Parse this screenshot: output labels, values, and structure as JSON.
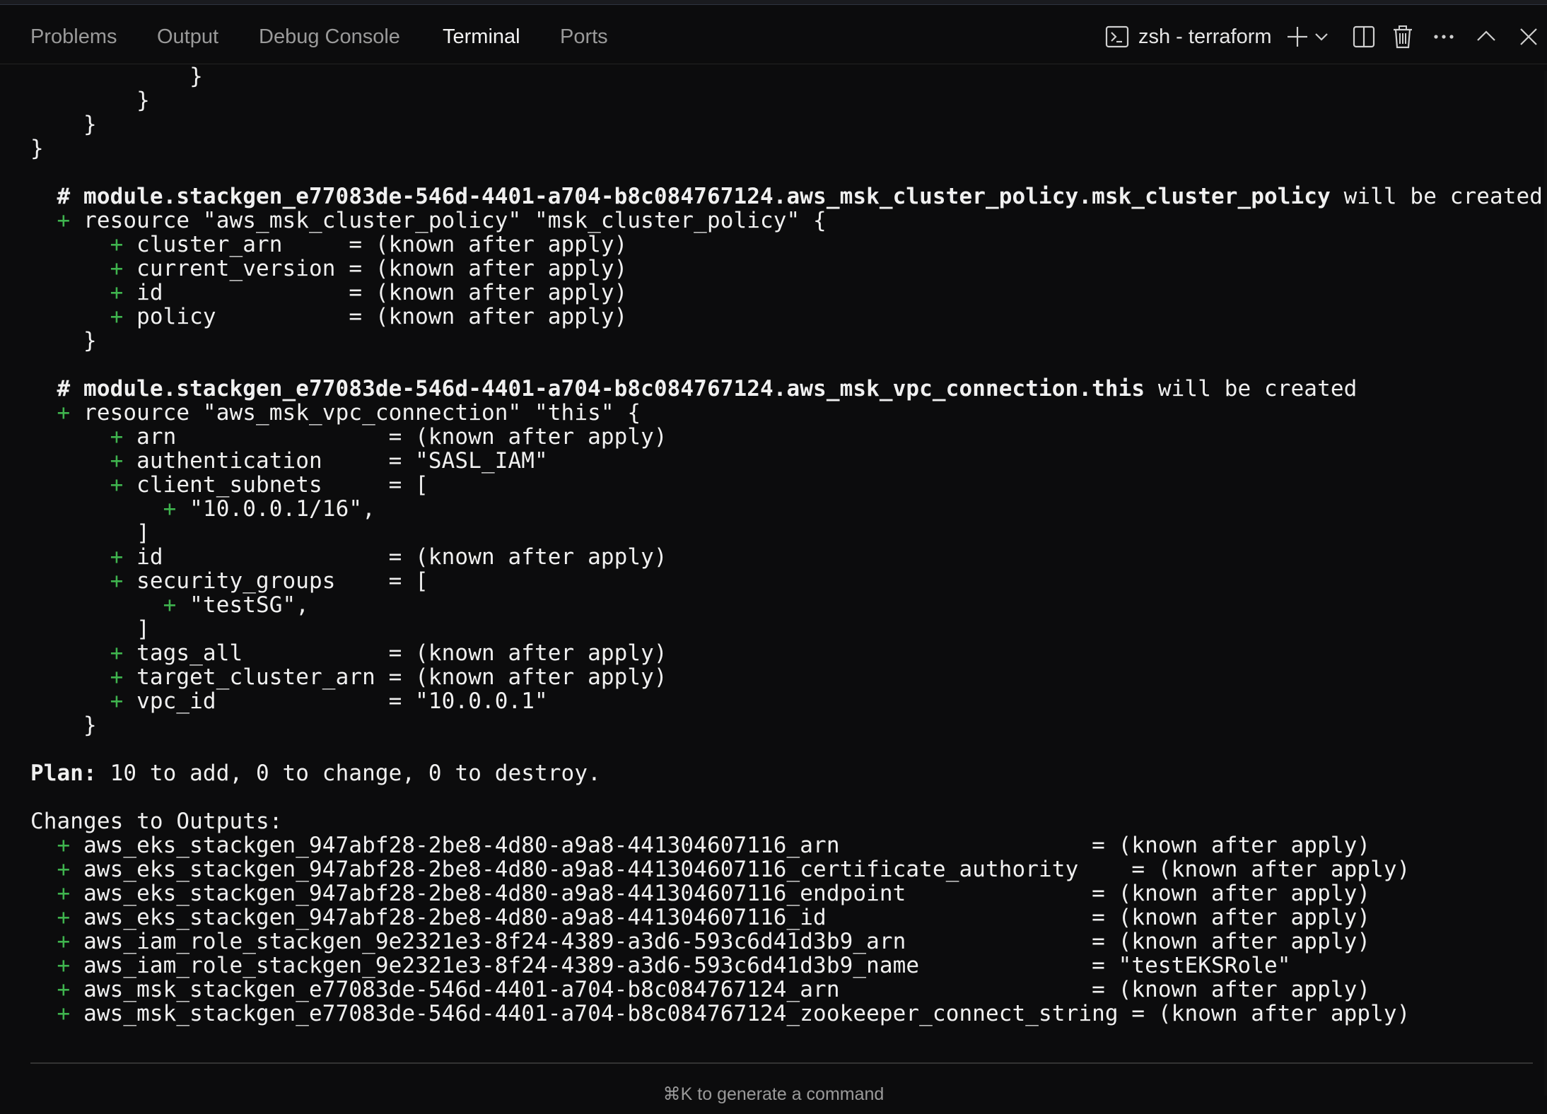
{
  "panel": {
    "tabs": [
      {
        "label": "Problems",
        "active": false
      },
      {
        "label": "Output",
        "active": false
      },
      {
        "label": "Debug Console",
        "active": false
      },
      {
        "label": "Terminal",
        "active": true
      },
      {
        "label": "Ports",
        "active": false
      }
    ],
    "terminal_name": "zsh - terraform",
    "icons": [
      "terminal-icon",
      "plus-icon",
      "chevron-down-icon",
      "split-icon",
      "trash-icon",
      "more-icon",
      "chevron-up-icon",
      "close-icon"
    ]
  },
  "colors": {
    "background": "#0c0c0d",
    "plus_sign": "#3fb44e",
    "text": "#f0f0f0",
    "tab_inactive": "#9a9a9a"
  },
  "terminal": {
    "lines": [
      {
        "segments": [
          {
            "text": "            }"
          }
        ]
      },
      {
        "segments": [
          {
            "text": "        }"
          }
        ]
      },
      {
        "segments": [
          {
            "text": "    }"
          }
        ]
      },
      {
        "segments": [
          {
            "text": "}"
          }
        ]
      },
      {
        "segments": [
          {
            "text": ""
          }
        ]
      },
      {
        "segments": [
          {
            "text": "  # module.stackgen_e77083de-546d-4401-a704-b8c084767124.aws_msk_cluster_policy.msk_cluster_policy",
            "bold": true
          },
          {
            "text": " will be created"
          }
        ]
      },
      {
        "segments": [
          {
            "text": "  + ",
            "plus": true
          },
          {
            "text": "resource \"aws_msk_cluster_policy\" \"msk_cluster_policy\" {"
          }
        ]
      },
      {
        "segments": [
          {
            "text": "      + ",
            "plus": true
          },
          {
            "text": "cluster_arn     = (known after apply)"
          }
        ]
      },
      {
        "segments": [
          {
            "text": "      + ",
            "plus": true
          },
          {
            "text": "current_version = (known after apply)"
          }
        ]
      },
      {
        "segments": [
          {
            "text": "      + ",
            "plus": true
          },
          {
            "text": "id              = (known after apply)"
          }
        ]
      },
      {
        "segments": [
          {
            "text": "      + ",
            "plus": true
          },
          {
            "text": "policy          = (known after apply)"
          }
        ]
      },
      {
        "segments": [
          {
            "text": "    }"
          }
        ]
      },
      {
        "segments": [
          {
            "text": ""
          }
        ]
      },
      {
        "segments": [
          {
            "text": "  # module.stackgen_e77083de-546d-4401-a704-b8c084767124.aws_msk_vpc_connection.this",
            "bold": true
          },
          {
            "text": " will be created"
          }
        ]
      },
      {
        "segments": [
          {
            "text": "  + ",
            "plus": true
          },
          {
            "text": "resource \"aws_msk_vpc_connection\" \"this\" {"
          }
        ]
      },
      {
        "segments": [
          {
            "text": "      + ",
            "plus": true
          },
          {
            "text": "arn                = (known after apply)"
          }
        ]
      },
      {
        "segments": [
          {
            "text": "      + ",
            "plus": true
          },
          {
            "text": "authentication     = \"SASL_IAM\""
          }
        ]
      },
      {
        "segments": [
          {
            "text": "      + ",
            "plus": true
          },
          {
            "text": "client_subnets     = ["
          }
        ]
      },
      {
        "segments": [
          {
            "text": "          + ",
            "plus": true
          },
          {
            "text": "\"10.0.0.1/16\","
          }
        ]
      },
      {
        "segments": [
          {
            "text": "        ]"
          }
        ]
      },
      {
        "segments": [
          {
            "text": "      + ",
            "plus": true
          },
          {
            "text": "id                 = (known after apply)"
          }
        ]
      },
      {
        "segments": [
          {
            "text": "      + ",
            "plus": true
          },
          {
            "text": "security_groups    = ["
          }
        ]
      },
      {
        "segments": [
          {
            "text": "          + ",
            "plus": true
          },
          {
            "text": "\"testSG\","
          }
        ]
      },
      {
        "segments": [
          {
            "text": "        ]"
          }
        ]
      },
      {
        "segments": [
          {
            "text": "      + ",
            "plus": true
          },
          {
            "text": "tags_all           = (known after apply)"
          }
        ]
      },
      {
        "segments": [
          {
            "text": "      + ",
            "plus": true
          },
          {
            "text": "target_cluster_arn = (known after apply)"
          }
        ]
      },
      {
        "segments": [
          {
            "text": "      + ",
            "plus": true
          },
          {
            "text": "vpc_id             = \"10.0.0.1\""
          }
        ]
      },
      {
        "segments": [
          {
            "text": "    }"
          }
        ]
      },
      {
        "segments": [
          {
            "text": ""
          }
        ]
      },
      {
        "segments": [
          {
            "text": "Plan:",
            "bold": true
          },
          {
            "text": " 10 to add, 0 to change, 0 to destroy."
          }
        ]
      },
      {
        "segments": [
          {
            "text": ""
          }
        ]
      },
      {
        "segments": [
          {
            "text": "Changes to Outputs:"
          }
        ]
      },
      {
        "segments": [
          {
            "text": "  + ",
            "plus": true
          },
          {
            "text": "aws_eks_stackgen_947abf28-2be8-4d80-a9a8-441304607116_arn                   = (known after apply)"
          }
        ]
      },
      {
        "segments": [
          {
            "text": "  + ",
            "plus": true
          },
          {
            "text": "aws_eks_stackgen_947abf28-2be8-4d80-a9a8-441304607116_certificate_authority    = (known after apply)"
          }
        ]
      },
      {
        "segments": [
          {
            "text": "  + ",
            "plus": true
          },
          {
            "text": "aws_eks_stackgen_947abf28-2be8-4d80-a9a8-441304607116_endpoint              = (known after apply)"
          }
        ]
      },
      {
        "segments": [
          {
            "text": "  + ",
            "plus": true
          },
          {
            "text": "aws_eks_stackgen_947abf28-2be8-4d80-a9a8-441304607116_id                    = (known after apply)"
          }
        ]
      },
      {
        "segments": [
          {
            "text": "  + ",
            "plus": true
          },
          {
            "text": "aws_iam_role_stackgen_9e2321e3-8f24-4389-a3d6-593c6d41d3b9_arn              = (known after apply)"
          }
        ]
      },
      {
        "segments": [
          {
            "text": "  + ",
            "plus": true
          },
          {
            "text": "aws_iam_role_stackgen_9e2321e3-8f24-4389-a3d6-593c6d41d3b9_name             = \"testEKSRole\""
          }
        ]
      },
      {
        "segments": [
          {
            "text": "  + ",
            "plus": true
          },
          {
            "text": "aws_msk_stackgen_e77083de-546d-4401-a704-b8c084767124_arn                   = (known after apply)"
          }
        ]
      },
      {
        "segments": [
          {
            "text": "  + ",
            "plus": true
          },
          {
            "text": "aws_msk_stackgen_e77083de-546d-4401-a704-b8c084767124_zookeeper_connect_string = (known after apply)"
          }
        ]
      }
    ]
  },
  "footer": {
    "hint": "⌘K to generate a command"
  }
}
